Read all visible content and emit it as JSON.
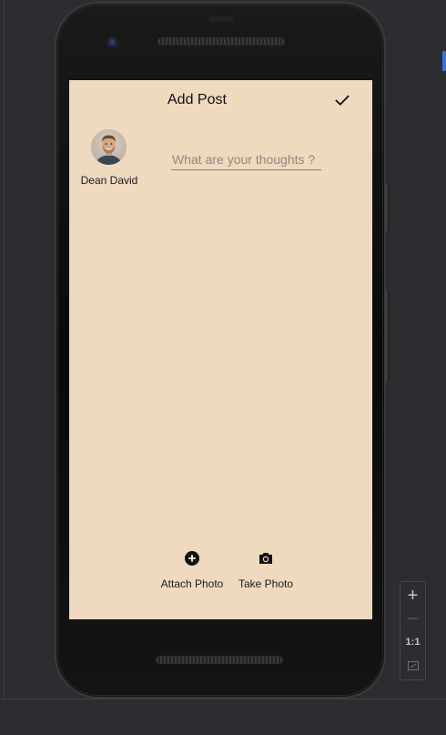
{
  "app": {
    "toolbar": {
      "title": "Add Post",
      "confirm_icon": "check-icon"
    },
    "user": {
      "name": "Dean David",
      "avatar_icon": "user-avatar"
    },
    "composer": {
      "placeholder": "What are your thoughts ?",
      "value": ""
    },
    "actions": [
      {
        "label": "Attach Photo",
        "icon": "add-circle-icon"
      },
      {
        "label": "Take Photo",
        "icon": "camera-icon"
      }
    ],
    "colors": {
      "screen_bg": "#efd9bf",
      "ide_bg": "#2b2d30",
      "accent": "#3b74d8"
    }
  },
  "ide": {
    "zoom_controls": {
      "zoom_in": "+",
      "zoom_out": "—",
      "actual_size": "1:1"
    }
  }
}
